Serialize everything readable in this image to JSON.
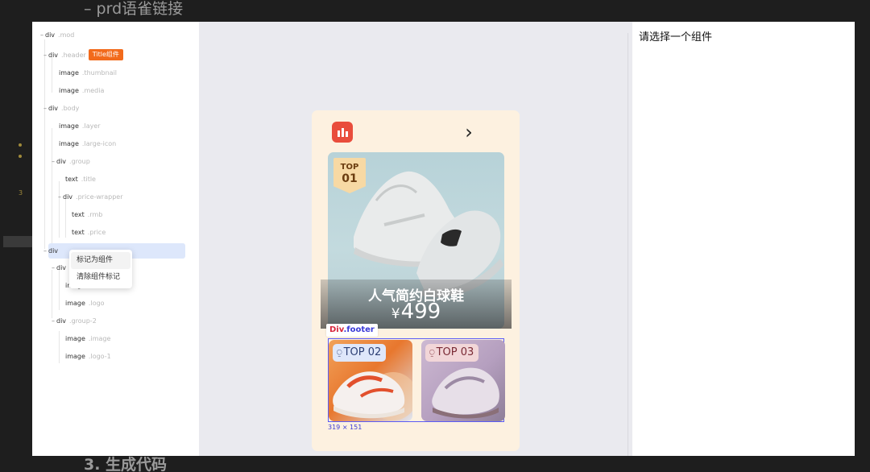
{
  "background": {
    "heading": "– prd语雀链接",
    "footer_heading": "3. 生成代码",
    "side_number": "3"
  },
  "tree": {
    "nodes": [
      {
        "tag": "div",
        "cls": ".mod"
      },
      {
        "tag": "div",
        "cls": ".header",
        "badge": "Title组件"
      },
      {
        "tag": "image",
        "cls": ".thumbnail"
      },
      {
        "tag": "image",
        "cls": ".media"
      },
      {
        "tag": "div",
        "cls": ".body"
      },
      {
        "tag": "image",
        "cls": ".layer"
      },
      {
        "tag": "image",
        "cls": ".large-icon"
      },
      {
        "tag": "div",
        "cls": ".group"
      },
      {
        "tag": "text",
        "cls": ".title"
      },
      {
        "tag": "div",
        "cls": ".price-wrapper"
      },
      {
        "tag": "text",
        "cls": ".rmb"
      },
      {
        "tag": "text",
        "cls": ".price"
      },
      {
        "tag": "div",
        "cls": ""
      },
      {
        "tag": "div",
        "cls": ""
      },
      {
        "tag": "image",
        "cls": ""
      },
      {
        "tag": "image",
        "cls": ".logo"
      },
      {
        "tag": "div",
        "cls": ".group-2"
      },
      {
        "tag": "image",
        "cls": ".image"
      },
      {
        "tag": "image",
        "cls": ".logo-1"
      }
    ],
    "context_menu": [
      "标记为组件",
      "清除组件标记"
    ]
  },
  "canvas": {
    "chevron": "›",
    "main_card": {
      "badge_top": "TOP",
      "badge_rank": "01",
      "name": "人气简约白球鞋",
      "currency": "¥",
      "price": "499"
    },
    "footer_tag_prefix": "Div",
    "footer_tag_suffix": ".footer",
    "tiles": [
      {
        "label": "TOP 02"
      },
      {
        "label": "TOP 03"
      }
    ],
    "dimensions": "319 × 151"
  },
  "props": {
    "title": "请选择一个组件"
  },
  "colors": {
    "accent_orange": "#f26a1b",
    "selection_blue": "#5b5bf5",
    "app_icon_red": "#e94d3c",
    "card_bg": "#fdf1e0"
  }
}
